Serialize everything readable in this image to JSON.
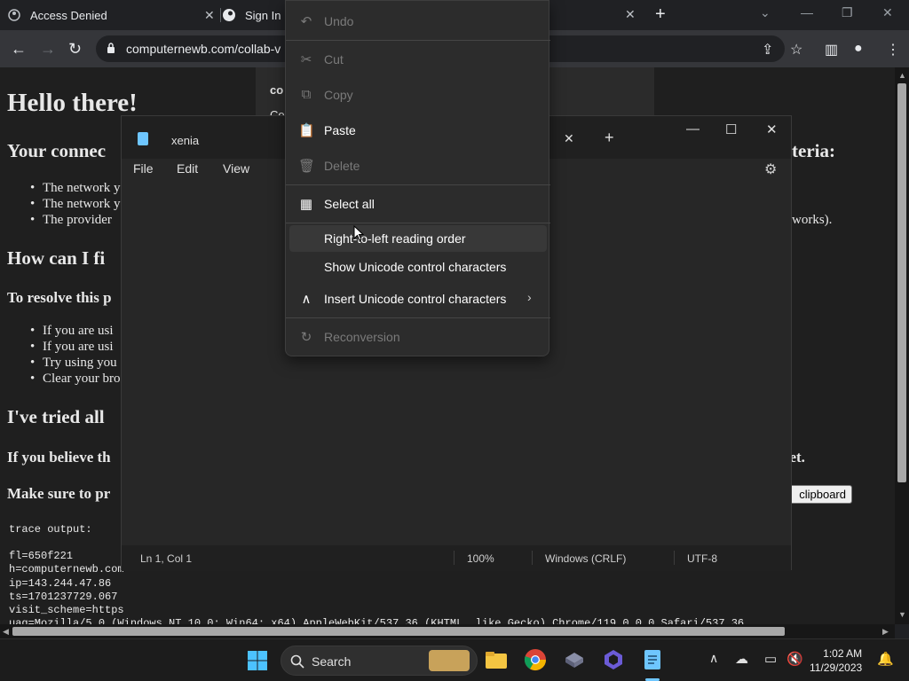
{
  "browser": {
    "tabs": [
      {
        "title": "Access Denied"
      },
      {
        "title": "Sign In"
      }
    ],
    "url": "computernewb.com/collab-v"
  },
  "webpage": {
    "heading": "Hello there!",
    "connection_heading": "Your connec",
    "connection_heading_tail": "teria:",
    "criteria": [
      "The network y",
      "The network y",
      "The provider"
    ],
    "criteria_tail": "works).",
    "fix_heading": "How can I fi",
    "resolve_heading": "To resolve this p",
    "steps": [
      "If you are usi",
      "If you are usi",
      "Try using you",
      "Clear your bro"
    ],
    "tried_heading": "I've tried all",
    "believe_heading": "If you believe th",
    "believe_tail": "ket.",
    "provide_heading": "Make sure to pr",
    "copy_button": "clipboard",
    "overlay_text_1": "co",
    "overlay_text_2": "Co",
    "trace_label": "trace output:",
    "trace": [
      "fl=650f221",
      "h=computernewb.com",
      "ip=143.244.47.86",
      "ts=1701237729.067",
      "visit_scheme=https",
      "uag=Mozilla/5.0 (Windows NT 10.0; Win64; x64) AppleWebKit/537.36 (KHTML, like Gecko) Chrome/119.0.0.0 Safari/537.36"
    ]
  },
  "notepad": {
    "tab_title": "xenia",
    "menu": [
      "File",
      "Edit",
      "View"
    ],
    "status": {
      "position": "Ln 1, Col 1",
      "zoom": "100%",
      "line_ending": "Windows (CRLF)",
      "encoding": "UTF-8"
    }
  },
  "context_menu": {
    "items": [
      {
        "label": "Undo",
        "icon": "undo-icon",
        "enabled": false
      },
      {
        "label": "Cut",
        "icon": "scissors-icon",
        "enabled": false
      },
      {
        "label": "Copy",
        "icon": "copy-icon",
        "enabled": false
      },
      {
        "label": "Paste",
        "icon": "clipboard-icon",
        "enabled": true
      },
      {
        "label": "Delete",
        "icon": "trash-icon",
        "enabled": false
      },
      {
        "label": "Select all",
        "icon": "select-all-icon",
        "enabled": true
      },
      {
        "label": "Right-to-left reading order",
        "icon": "",
        "enabled": true
      },
      {
        "label": "Show Unicode control characters",
        "icon": "",
        "enabled": true
      },
      {
        "label": "Insert Unicode control characters",
        "icon": "caret-icon",
        "enabled": true
      },
      {
        "label": "Reconversion",
        "icon": "reconversion-icon",
        "enabled": false
      }
    ]
  },
  "taskbar": {
    "search_label": "Search",
    "time": "1:02 AM",
    "date": "11/29/2023"
  },
  "colors": {
    "accent": "#6ec6ff",
    "menu_bg": "#2c2c2c",
    "disabled_text": "#7a7a7a"
  }
}
